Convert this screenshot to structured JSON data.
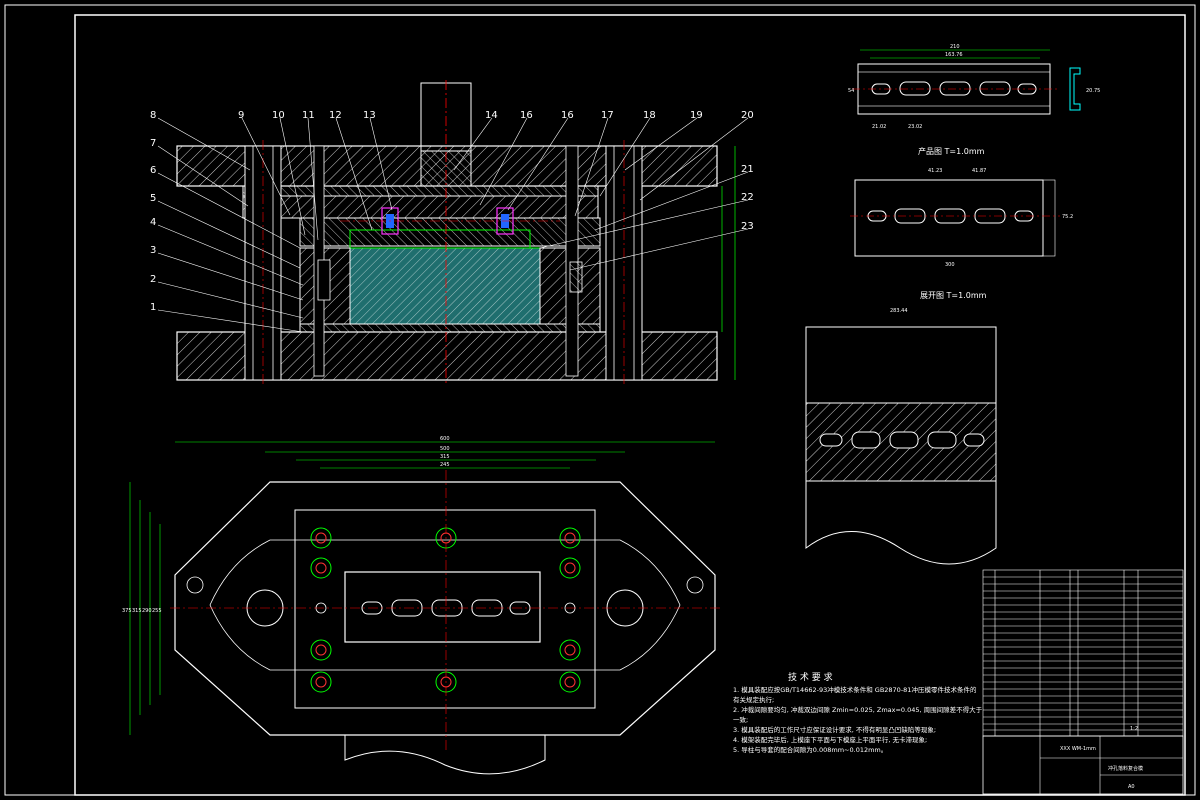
{
  "drawing": {
    "callouts": [
      "1",
      "2",
      "3",
      "4",
      "5",
      "6",
      "7",
      "8",
      "9",
      "10",
      "11",
      "12",
      "13",
      "14",
      "16",
      "16",
      "17",
      "18",
      "19",
      "20",
      "21",
      "22",
      "23"
    ],
    "views": {
      "product_title": "产品图  T=1.0mm",
      "blank_title": "展开图  T=1.0mm"
    },
    "tech_requirements": {
      "title": "技 术 要 求",
      "lines": [
        "1. 模具装配应按GB/T14662-93冲模技术条件和 GB2870-81冲压模零件技术条件的",
        "   有关规定执行;",
        "2. 冲裁间隙要均匀, 冲裁双边间隙 Zmin=0.025, Zmax=0.045, 周围间隙差不得大于",
        "   一致;",
        "3. 模具装配后的工作尺寸应保证设计要求, 不得有明显凸凹缺陷等现象;",
        "4. 模架装配完毕后, 上模座下平面与下模座上平面平行, 无卡滞现象;",
        "5. 导柱与导套的配合间隙为0.008mm~0.012mm。"
      ]
    },
    "dimensions": {
      "product_width": "210",
      "product_sub": "163.76",
      "product_d1": "21.02",
      "product_d2": "23.02",
      "product_height": "54",
      "product_side": "20.75",
      "blank_d1": "41.23",
      "blank_d2": "41.87",
      "blank_height": "75.2",
      "blank_width": "300",
      "strip_width": "283.44",
      "plan_overall": "600",
      "plan_inner1": "500",
      "plan_inner2": "315",
      "plan_inner3": "245",
      "plan_h1": "375",
      "plan_h2": "315",
      "plan_h3": "290",
      "plan_h4": "255"
    },
    "title_block": {
      "part_name": "冲孔落料复合模",
      "drawing_no": "XXX  WM-1mm",
      "scale_label": "1:2",
      "sheet": "A0"
    },
    "colors": {
      "background": "#000000",
      "outline": "#ffffff",
      "dimension": "#00ff00",
      "centerline": "#ff0000",
      "hatch": "#ffffff",
      "section_fill": "#2e8b8b"
    }
  }
}
